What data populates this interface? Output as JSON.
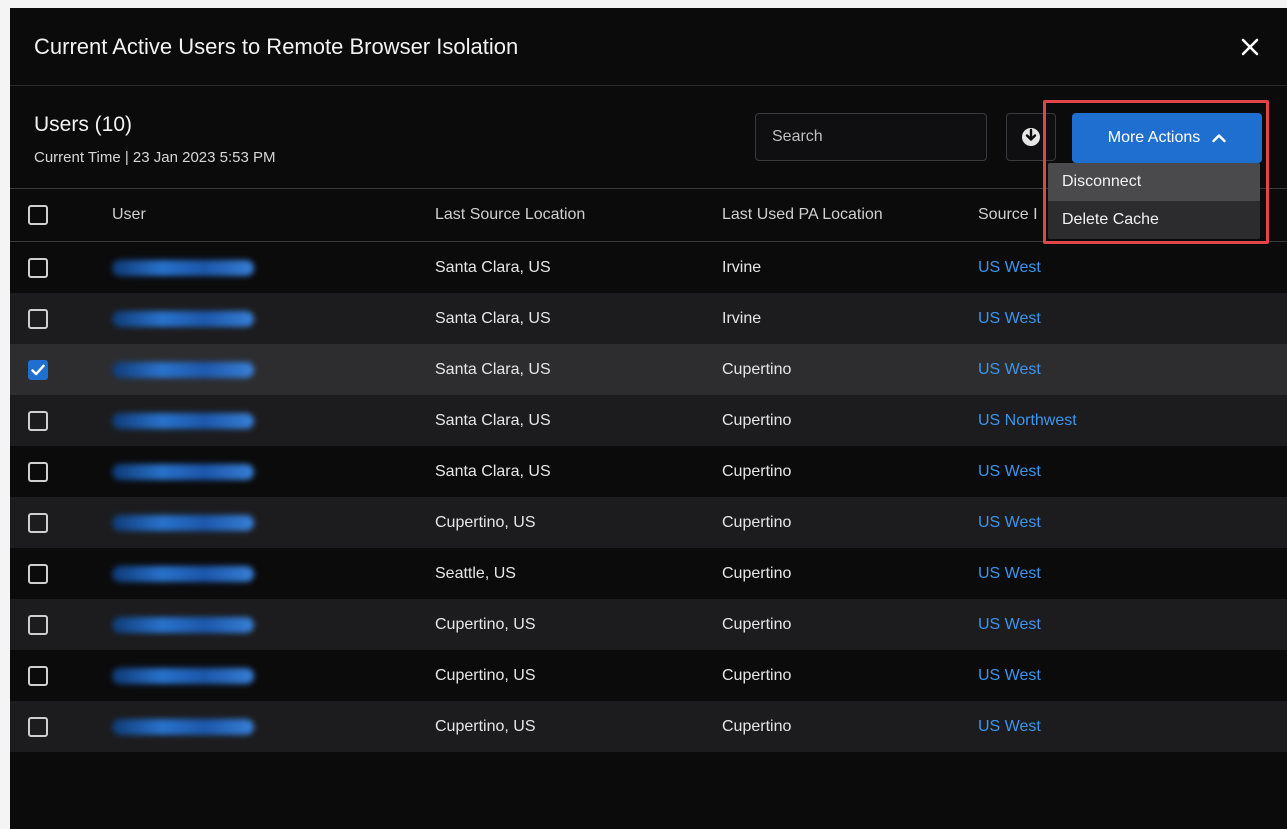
{
  "modal": {
    "title": "Current Active Users to Remote Browser Isolation"
  },
  "toolbar": {
    "users_heading": "Users (10)",
    "current_time": "Current Time | 23 Jan 2023 5:53 PM",
    "search_placeholder": "Search",
    "more_actions_label": "More Actions"
  },
  "dropdown": {
    "items": [
      {
        "label": "Disconnect"
      },
      {
        "label": "Delete Cache"
      }
    ]
  },
  "table": {
    "columns": {
      "user": "User",
      "last_source_location": "Last Source Location",
      "last_used_pa_location": "Last Used PA Location",
      "source_region": "Source I"
    },
    "rows": [
      {
        "user": "user@email.com",
        "source": "Santa Clara, US",
        "pa": "Irvine",
        "region": "US West",
        "checked": false
      },
      {
        "user": "user@email.com",
        "source": "Santa Clara, US",
        "pa": "Irvine",
        "region": "US West",
        "checked": false
      },
      {
        "user": "user@email.com",
        "source": "Santa Clara, US",
        "pa": "Cupertino",
        "region": "US West",
        "checked": true
      },
      {
        "user": "user@email.com",
        "source": "Santa Clara, US",
        "pa": "Cupertino",
        "region": "US Northwest",
        "checked": false
      },
      {
        "user": "user@email.com",
        "source": "Santa Clara, US",
        "pa": "Cupertino",
        "region": "US West",
        "checked": false
      },
      {
        "user": "user@email.com",
        "source": "Cupertino, US",
        "pa": "Cupertino",
        "region": "US West",
        "checked": false
      },
      {
        "user": "user@email.com",
        "source": "Seattle, US",
        "pa": "Cupertino",
        "region": "US West",
        "checked": false
      },
      {
        "user": "user@email.com",
        "source": "Cupertino, US",
        "pa": "Cupertino",
        "region": "US West",
        "checked": false
      },
      {
        "user": "user@email.com",
        "source": "Cupertino, US",
        "pa": "Cupertino",
        "region": "US West",
        "checked": false
      },
      {
        "user": "user@email.com",
        "source": "Cupertino, US",
        "pa": "Cupertino",
        "region": "US West",
        "checked": false
      }
    ]
  },
  "colors": {
    "accent": "#1f6fd1",
    "link": "#3b95ef",
    "highlight": "#e0454a"
  },
  "icons": {
    "close": "close-icon",
    "search": "search-icon",
    "download": "download-icon",
    "chevron": "chevron-up-icon",
    "check": "check-icon"
  }
}
